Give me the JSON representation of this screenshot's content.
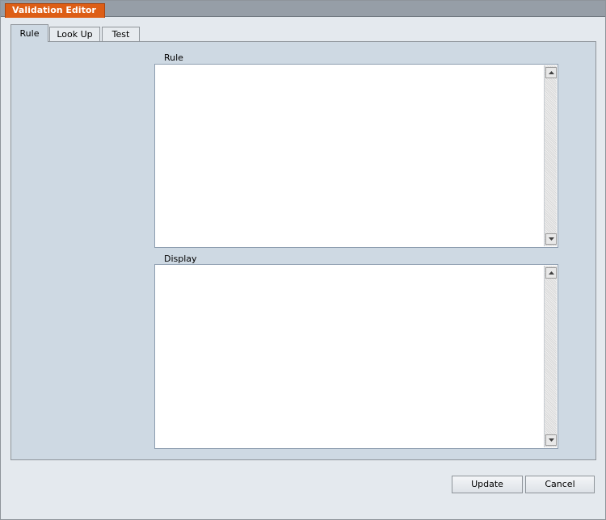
{
  "window": {
    "title": "Validation Editor"
  },
  "tabs": [
    {
      "label": "Rule",
      "active": true
    },
    {
      "label": "Look Up",
      "active": false
    },
    {
      "label": "Test",
      "active": false
    }
  ],
  "form": {
    "rule_label": "Rule",
    "rule_value": "",
    "display_label": "Display",
    "display_value": ""
  },
  "buttons": {
    "update": "Update",
    "cancel": "Cancel"
  },
  "icons": {
    "scroll_up": "triangle-up-icon",
    "scroll_down": "triangle-down-icon"
  },
  "colors": {
    "title_accent": "#dd5e16",
    "panel_background": "#ced9e3"
  }
}
